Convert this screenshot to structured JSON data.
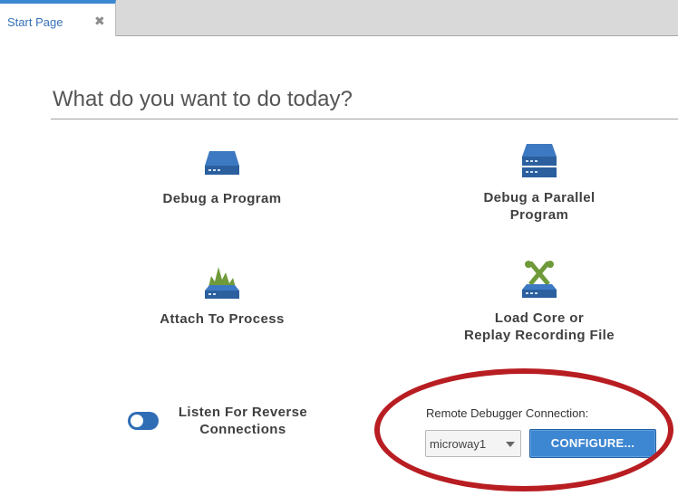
{
  "tabs": [
    {
      "label": "Start Page",
      "close": "✖"
    }
  ],
  "main": {
    "heading": "What do you want to do today?",
    "actions": {
      "debug_program": "Debug a Program",
      "debug_parallel": "Debug a Parallel\nProgram",
      "attach_process": "Attach To Process",
      "load_core": "Load Core or\nReplay Recording File"
    },
    "listen_label": "Listen For Reverse\nConnections",
    "listen_enabled": true,
    "remote": {
      "label": "Remote Debugger Connection:",
      "selected": "microway1",
      "configure_label": "CONFIGURE..."
    }
  },
  "colors": {
    "accent": "#3d86d1",
    "icon_blue": "#2f66a9",
    "annotation": "#b81d22"
  }
}
